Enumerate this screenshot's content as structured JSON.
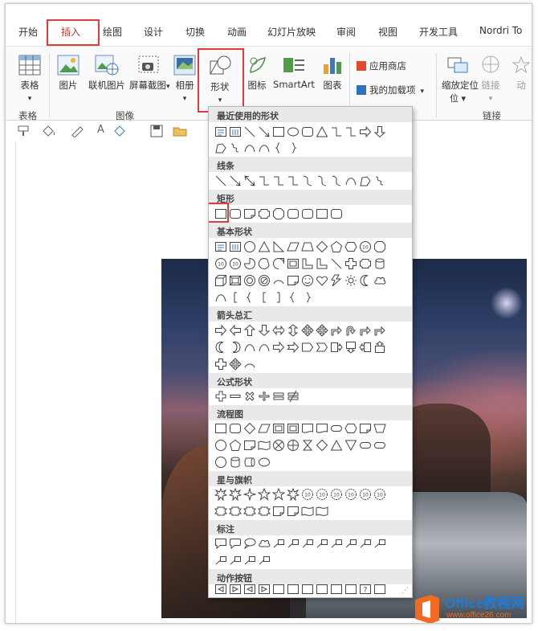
{
  "tabs": [
    "开始",
    "插入",
    "绘图",
    "设计",
    "切换",
    "动画",
    "幻灯片放映",
    "审阅",
    "视图",
    "开发工具",
    "Nordri To"
  ],
  "ribbon": {
    "table": "表格",
    "picture": "图片",
    "online_picture": "联机图片",
    "screenshot": "屏幕截图",
    "album": "相册",
    "shapes": "形状",
    "icons": "图标",
    "smartart": "SmartArt",
    "chart": "图表",
    "store": "应用商店",
    "my_addins": "我的加载项",
    "zoom": "缩放定位",
    "link": "链接",
    "action": "动",
    "groups": {
      "table": "表格",
      "images": "图像",
      "links": "链接"
    }
  },
  "shapes_menu": {
    "sections": [
      "最近使用的形状",
      "线条",
      "矩形",
      "基本形状",
      "箭头总汇",
      "公式形状",
      "流程图",
      "星与旗帜",
      "标注",
      "动作按钮"
    ]
  },
  "watermark": {
    "brand": "Office教程网",
    "url": "www.office26.com"
  },
  "colors": {
    "highlight": "#e23b3b",
    "logo_orange": "#f26a22",
    "logo_blue": "#1e7bd6"
  }
}
